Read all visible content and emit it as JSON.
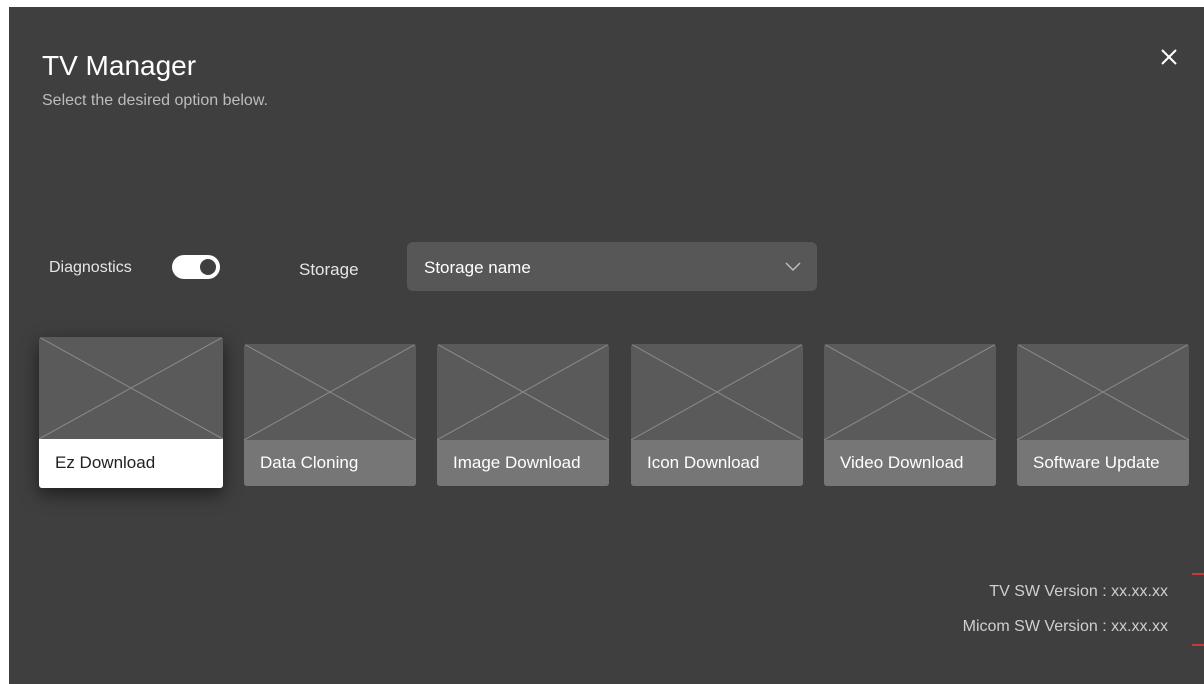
{
  "header": {
    "title": "TV Manager",
    "subtitle": "Select the desired option below."
  },
  "icons": {
    "close": "close-icon",
    "dropdown": "chevron-down-icon"
  },
  "controls": {
    "diagnostics_label": "Diagnostics",
    "diagnostics_enabled": true,
    "storage_label": "Storage",
    "storage_value": "Storage name"
  },
  "cards": [
    {
      "label": "Ez Download",
      "selected": true
    },
    {
      "label": "Data Cloning",
      "selected": false
    },
    {
      "label": "Image Download",
      "selected": false
    },
    {
      "label": "Icon Download",
      "selected": false
    },
    {
      "label": "Video Download",
      "selected": false
    },
    {
      "label": "Software Update",
      "selected": false
    }
  ],
  "versions": {
    "tv_sw": "TV SW Version : xx.xx.xx",
    "micom_sw": "Micom SW Version : xx.xx.xx"
  },
  "colors": {
    "panel_bg": "#3f3f3f",
    "card_bg": "#5a5a5a",
    "card_label_bg": "#767676",
    "selected_label_bg": "#ffffff",
    "accent_tick": "#c43a3a"
  }
}
